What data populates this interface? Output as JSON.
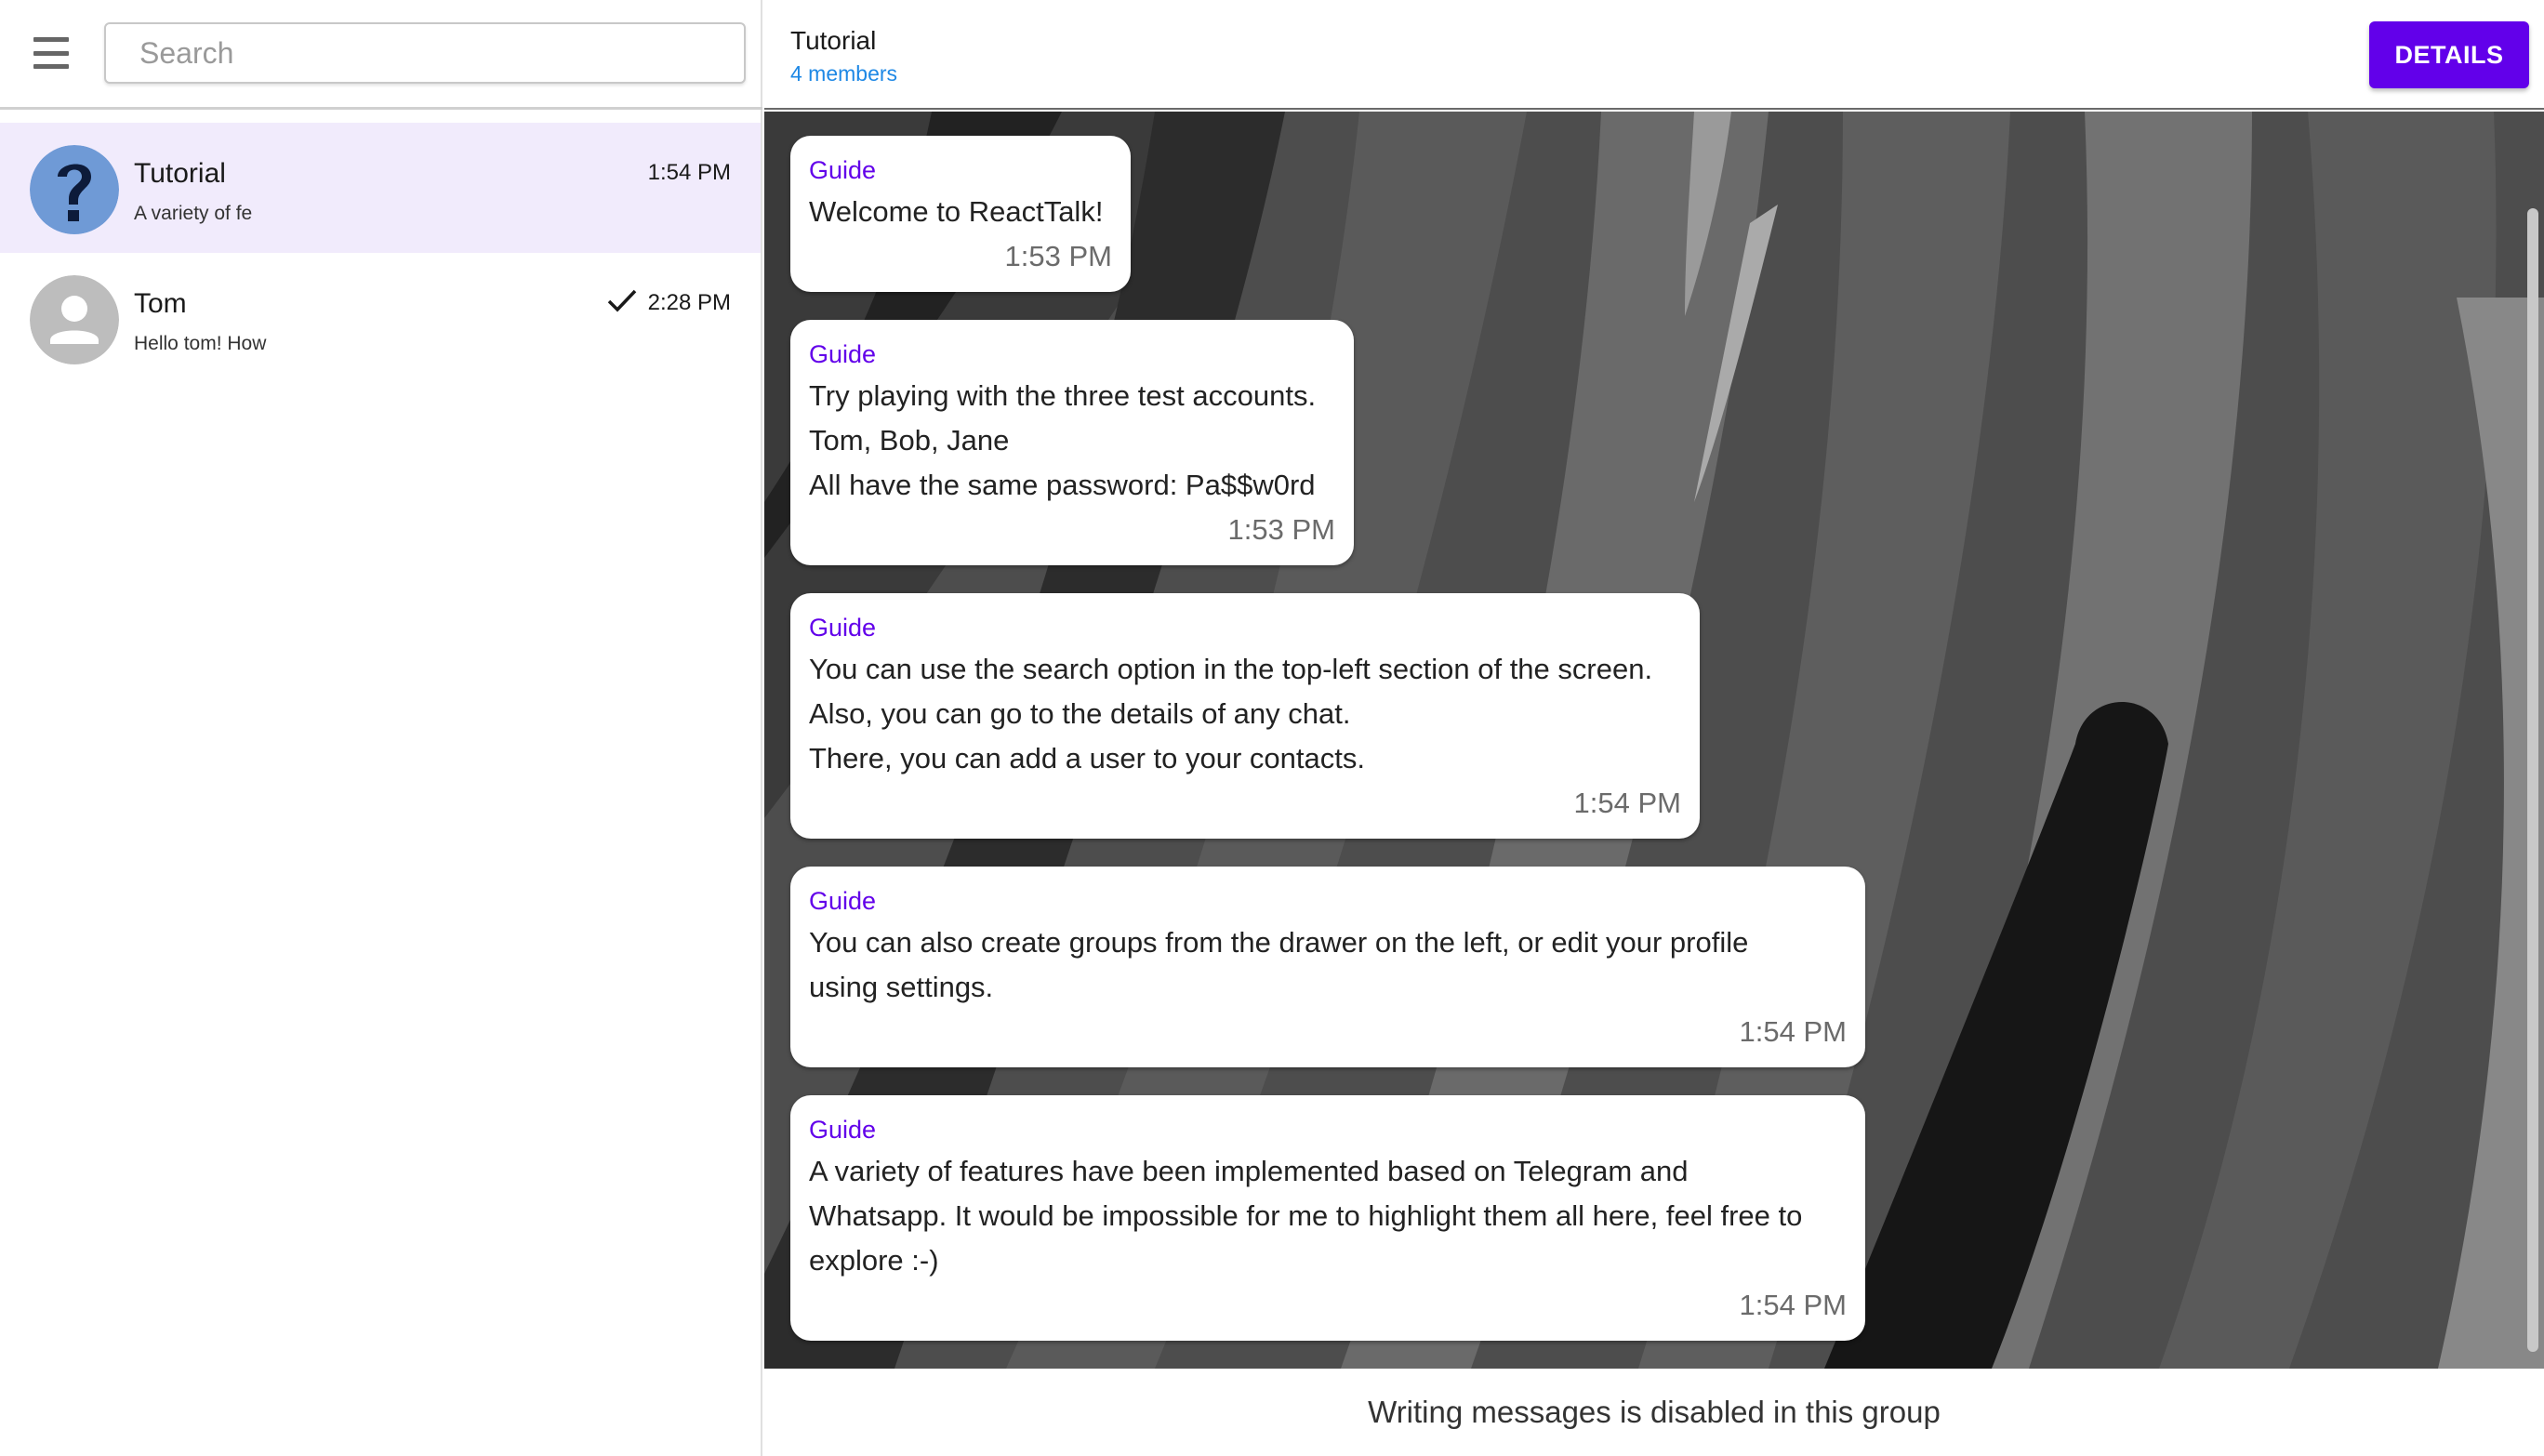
{
  "sidebar": {
    "search_placeholder": "Search",
    "chats": [
      {
        "name": "Tutorial",
        "preview": "A variety of fe",
        "time": "1:54 PM",
        "active": true,
        "avatar_icon": "question-mark-icon"
      },
      {
        "name": "Tom",
        "preview": "Hello tom! How",
        "time": "2:28 PM",
        "active": false,
        "avatar_icon": "person-icon",
        "read_status": "check-icon"
      }
    ]
  },
  "header": {
    "title": "Tutorial",
    "subtitle": "4 members",
    "details_label": "DETAILS"
  },
  "messages": [
    {
      "sender": "Guide",
      "lines": [
        "Welcome to ReactTalk!"
      ],
      "time": "1:53 PM"
    },
    {
      "sender": "Guide",
      "lines": [
        "Try playing with the three test accounts.",
        "Tom, Bob, Jane",
        "All have the same password: Pa$$w0rd"
      ],
      "time": "1:53 PM"
    },
    {
      "sender": "Guide",
      "lines": [
        "You can use the search option in the top-left section of the screen.",
        "Also, you can go to the details of any chat.",
        "There, you can add a user to your contacts."
      ],
      "time": "1:54 PM"
    },
    {
      "sender": "Guide",
      "lines": [
        "You can also create groups from the drawer on the left, or edit your profile",
        "using settings."
      ],
      "time": "1:54 PM"
    },
    {
      "sender": "Guide",
      "lines": [
        "A variety of features have been implemented based on Telegram and",
        "Whatsapp. It would be impossible for me to highlight them all here, feel free to",
        "explore :-)"
      ],
      "time": "1:54 PM"
    }
  ],
  "footer": {
    "notice": "Writing messages is disabled in this group"
  },
  "colors": {
    "accent": "#6200ea",
    "subtitle_blue": "#1e88e5",
    "active_chat_bg": "#f1ebfc"
  }
}
